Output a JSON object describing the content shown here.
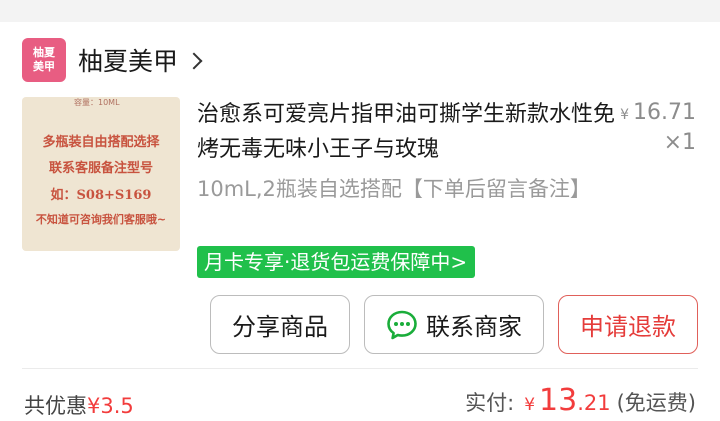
{
  "store": {
    "logo_line1": "柚夏",
    "logo_line2": "美甲",
    "name": "柚夏美甲"
  },
  "product": {
    "thumb": {
      "capacity_tag": "容量：10ML",
      "line1": "多瓶装自由搭配选择",
      "line2": "联系客服备注型号",
      "line3": "如：S08+S169",
      "line4": "不知道可咨询我们客服哦~"
    },
    "title": "治愈系可爱亮片指甲油可撕学生新款水性免烤无毒无味小王子与玫瑰",
    "price_symbol": "¥",
    "price": "16.71",
    "quantity": "×1",
    "spec": "10mL,2瓶装自选搭配【下单后留言备注】",
    "promo": "月卡专享·退货包运费保障中>"
  },
  "actions": {
    "share_label": "分享商品",
    "contact_label": "联系商家",
    "refund_label": "申请退款"
  },
  "summary": {
    "discount_label": "共优惠",
    "discount_amount": "¥3.5",
    "paid_label": "实付:",
    "paid_symbol": "¥",
    "paid_int": "13",
    "paid_dec": ".21",
    "shipping": "(免运费)"
  },
  "colors": {
    "logo_bg": "#e85d82",
    "promo_bg": "#20c04b",
    "accent_red": "#f23c3c",
    "chat_green": "#1aad3a"
  }
}
